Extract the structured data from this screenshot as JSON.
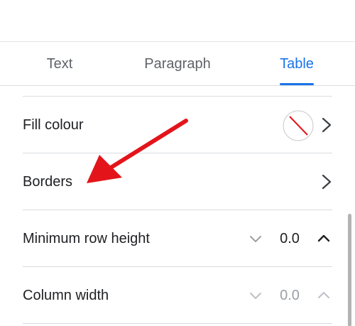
{
  "tabs": [
    {
      "label": "Text",
      "active": false
    },
    {
      "label": "Paragraph",
      "active": false
    },
    {
      "label": "Table",
      "active": true
    }
  ],
  "rows": {
    "fill_colour": {
      "label": "Fill colour",
      "swatch": "none"
    },
    "borders": {
      "label": "Borders"
    },
    "min_row_height": {
      "label": "Minimum row height",
      "value": "0.0"
    },
    "column_width": {
      "label": "Column width",
      "value": "0.0",
      "disabled": true
    }
  },
  "colors": {
    "accent": "#1a73e8",
    "text": "#202124",
    "muted": "#9aa0a6",
    "annotation_arrow": "#e3151a"
  },
  "icons": [
    "chevron-right-icon",
    "chevron-down-icon",
    "chevron-up-icon",
    "no-fill-swatch-icon"
  ]
}
